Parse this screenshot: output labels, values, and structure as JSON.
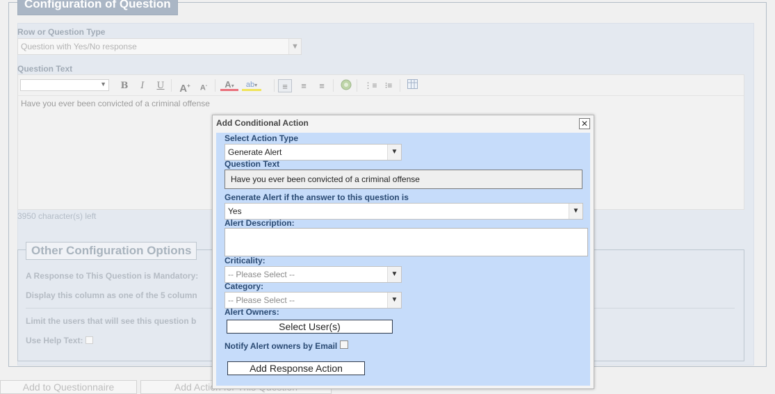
{
  "page": {
    "section_title": "Configuration of Question",
    "row_type": {
      "label": "Row or Question Type",
      "value": "Question with Yes/No response"
    },
    "question_text": {
      "label": "Question Text",
      "value": "Have you ever been convicted of a criminal offense",
      "chars_left": "3950 character(s) left"
    },
    "other_options": {
      "title": "Other Configuration Options",
      "mandatory_label": "A Response to This Question is Mandatory:",
      "display_column_label": "Display this column as one of the 5 column",
      "limit_users_label": "Limit the users that will see this question b",
      "help_text_label": "Use Help Text:"
    },
    "buttons": {
      "add_to_questionnaire": "Add to Questionnaire",
      "add_action": "Add Action for This Question"
    }
  },
  "modal": {
    "title": "Add Conditional Action",
    "close_glyph": "✕",
    "action_type": {
      "label": "Select Action Type",
      "value": "Generate Alert"
    },
    "question_text": {
      "label": "Question Text",
      "value": "Have you ever been convicted of a criminal offense"
    },
    "alert_answer": {
      "label": "Generate Alert if the answer to this question is",
      "value": "Yes"
    },
    "alert_description": {
      "label": "Alert Description:",
      "value": ""
    },
    "criticality": {
      "label": "Criticality:",
      "value": "-- Please Select --"
    },
    "category": {
      "label": "Category:",
      "value": "-- Please Select --"
    },
    "alert_owners": {
      "label": "Alert Owners:",
      "button": "Select User(s)"
    },
    "notify_label": "Notify Alert owners by Email",
    "add_response_button": "Add Response Action"
  },
  "toolbar_icons": [
    "bold-icon",
    "italic-icon",
    "underline-icon",
    "font-size-increase-icon",
    "font-size-decrease-icon",
    "font-color-icon",
    "highlight-color-icon",
    "align-left-icon",
    "align-center-icon",
    "align-right-icon",
    "insert-image-icon",
    "ordered-list-icon",
    "unordered-list-icon",
    "table-icon"
  ],
  "colors": {
    "panel_bg": "#d6dde9",
    "modal_body_bg": "#c6dcfa",
    "legend_bg": "#7d90a6",
    "label_blue": "#2a4a73"
  }
}
